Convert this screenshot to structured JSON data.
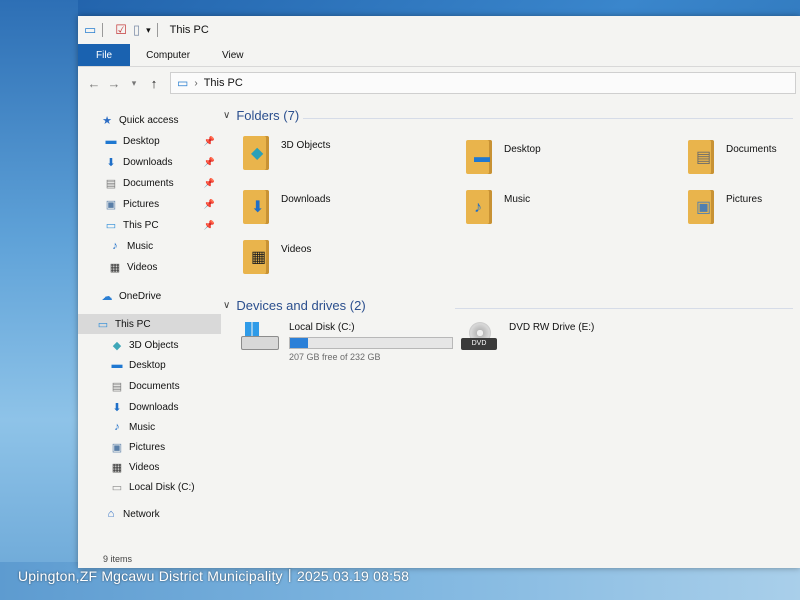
{
  "window": {
    "title": "This PC"
  },
  "ribbon": {
    "tabs": [
      "File",
      "Computer",
      "View"
    ]
  },
  "address": {
    "location": "This PC"
  },
  "sidebar": {
    "items": [
      {
        "label": "Quick access",
        "icon": "star-icon",
        "glyph": "★",
        "color": "#2b6cc4",
        "pinned": false
      },
      {
        "label": "Desktop",
        "icon": "desktop-icon",
        "glyph": "▬",
        "color": "#1f78d1",
        "pinned": true
      },
      {
        "label": "Downloads",
        "icon": "download-arrow-icon",
        "glyph": "⬇",
        "color": "#1f6fc8",
        "pinned": true
      },
      {
        "label": "Documents",
        "icon": "document-icon",
        "glyph": "▤",
        "color": "#7a7a7a",
        "pinned": true
      },
      {
        "label": "Pictures",
        "icon": "picture-icon",
        "glyph": "▣",
        "color": "#5a7fa8",
        "pinned": true
      },
      {
        "label": "This PC",
        "icon": "computer-icon",
        "glyph": "▭",
        "color": "#2a8bd8",
        "pinned": true
      },
      {
        "label": "Music",
        "icon": "music-note-icon",
        "glyph": "♪",
        "color": "#1f6fc8",
        "pinned": false
      },
      {
        "label": "Videos",
        "icon": "film-icon",
        "glyph": "▦",
        "color": "#333333",
        "pinned": false
      },
      {
        "label": "OneDrive",
        "icon": "cloud-icon",
        "glyph": "☁",
        "color": "#2b7fd4",
        "pinned": false
      },
      {
        "label": "This PC",
        "icon": "computer-icon",
        "glyph": "▭",
        "color": "#2a8bd8",
        "pinned": false,
        "selected": true
      },
      {
        "label": "3D Objects",
        "icon": "cube-icon",
        "glyph": "◆",
        "color": "#3fa7b8",
        "pinned": false
      },
      {
        "label": "Desktop",
        "icon": "desktop-icon",
        "glyph": "▬",
        "color": "#1f78d1",
        "pinned": false
      },
      {
        "label": "Documents",
        "icon": "document-icon",
        "glyph": "▤",
        "color": "#7a7a7a",
        "pinned": false
      },
      {
        "label": "Downloads",
        "icon": "download-arrow-icon",
        "glyph": "⬇",
        "color": "#1f6fc8",
        "pinned": false
      },
      {
        "label": "Music",
        "icon": "music-note-icon",
        "glyph": "♪",
        "color": "#1f6fc8",
        "pinned": false
      },
      {
        "label": "Pictures",
        "icon": "picture-icon",
        "glyph": "▣",
        "color": "#5a7fa8",
        "pinned": false
      },
      {
        "label": "Videos",
        "icon": "film-icon",
        "glyph": "▦",
        "color": "#333333",
        "pinned": false
      },
      {
        "label": "Local Disk (C:)",
        "icon": "drive-icon",
        "glyph": "▭",
        "color": "#8a8a8a",
        "pinned": false
      },
      {
        "label": "Network",
        "icon": "network-icon",
        "glyph": "⌂",
        "color": "#2b6cc4",
        "pinned": false
      }
    ]
  },
  "folders": {
    "header": "Folders (7)",
    "items": [
      {
        "label": "3D Objects",
        "icon": "3d-objects-folder-icon",
        "overlay": "◆",
        "overlay_color": "#2aa0b8"
      },
      {
        "label": "Desktop",
        "icon": "desktop-folder-icon",
        "overlay": "▬",
        "overlay_color": "#1f78d1"
      },
      {
        "label": "Documents",
        "icon": "documents-folder-icon",
        "overlay": "▤",
        "overlay_color": "#6b6b6b"
      },
      {
        "label": "Downloads",
        "icon": "downloads-folder-icon",
        "overlay": "⬇",
        "overlay_color": "#1f6fc8"
      },
      {
        "label": "Music",
        "icon": "music-folder-icon",
        "overlay": "♪",
        "overlay_color": "#1f6fc8"
      },
      {
        "label": "Pictures",
        "icon": "pictures-folder-icon",
        "overlay": "▣",
        "overlay_color": "#4f7fb0"
      },
      {
        "label": "Videos",
        "icon": "videos-folder-icon",
        "overlay": "▦",
        "overlay_color": "#222222"
      }
    ]
  },
  "drives": {
    "header": "Devices and drives (2)",
    "local": {
      "name": "Local Disk (C:)",
      "free_text": "207 GB free of 232 GB",
      "used_fraction": 0.11,
      "bar_color": "#2b80d8"
    },
    "dvd": {
      "name": "DVD RW Drive (E:)",
      "badge": "DVD"
    }
  },
  "status": {
    "items_text": "9 items"
  },
  "overlay": {
    "text": "Upington,ZF Mgcawu District Municipality丨2025.03.19 08:58"
  }
}
